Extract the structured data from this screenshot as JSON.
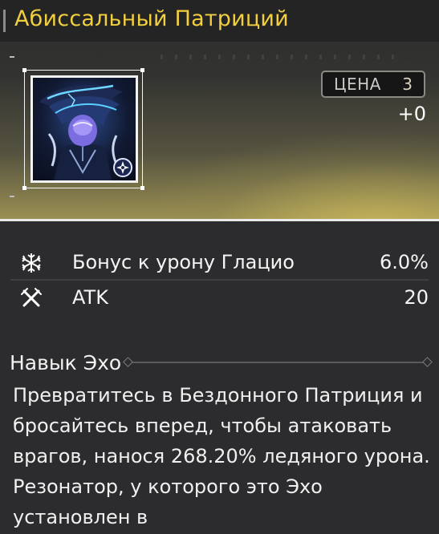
{
  "echo": {
    "name": "Абиссальный Патриций",
    "cost_label": "ЦЕНА",
    "cost_value": "3",
    "level": "+0",
    "portrait_icon": "abyssal-patricius-portrait",
    "element_icon": "compass-star-icon"
  },
  "stats": [
    {
      "icon": "snowflake-icon",
      "name": "Бонус к урону Глацио",
      "value": "6.0%"
    },
    {
      "icon": "crossed-swords-icon",
      "name": "ATK",
      "value": "20"
    }
  ],
  "skill": {
    "title": "Навык Эхо",
    "description": "Превратитесь в Бездонного Патриция и бросайтесь вперед, чтобы атаковать врагов, нанося 268.20% ледяного урона. Резонатор, у которого это Эхо установлен в"
  },
  "colors": {
    "title": "#f1cf3f",
    "accent_glow": "#d7c35f",
    "background": "#2c2c2e"
  }
}
